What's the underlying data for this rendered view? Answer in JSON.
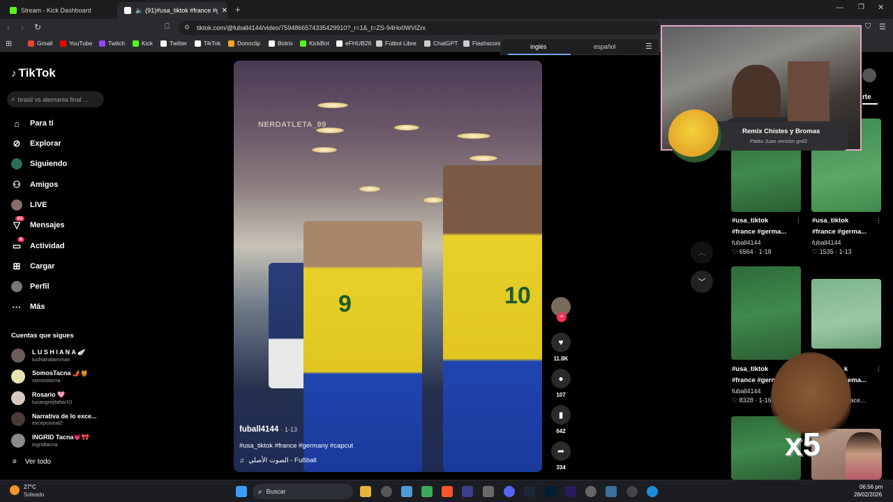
{
  "browser": {
    "tabs": [
      {
        "title": "Stream - Kick Dashboard",
        "color": "#53fc18"
      },
      {
        "title": "(91)#usa_tiktok #france #germ",
        "color": "#ffffff"
      }
    ],
    "url": "tiktok.com/@fuball4144/video/7594866574335429910?_r=1&_t=ZS-94Ho0WVlZrx",
    "bookmarks": [
      {
        "label": "Gmail",
        "color": "#ea4335"
      },
      {
        "label": "YouTube",
        "color": "#ff0000"
      },
      {
        "label": "Twitch",
        "color": "#9146ff"
      },
      {
        "label": "Kick",
        "color": "#53fc18"
      },
      {
        "label": "Twitter",
        "color": "#ffffff"
      },
      {
        "label": "TikTok",
        "color": "#ffffff"
      },
      {
        "label": "Donoclip",
        "color": "#f5a623"
      },
      {
        "label": "Botrix",
        "color": "#ffffff"
      },
      {
        "label": "KickBot",
        "color": "#53fc18"
      },
      {
        "label": "eFHUB26",
        "color": "#ffffff"
      },
      {
        "label": "Fútbol Libre",
        "color": "#cccccc"
      },
      {
        "label": "ChatGPT",
        "color": "#cccccc"
      },
      {
        "label": "Flashscore",
        "color": "#cccccc"
      }
    ],
    "translate": {
      "lang1": "inglés",
      "lang2": "español"
    }
  },
  "sidebar": {
    "logo": "TikTok",
    "search_placeholder": "brasil vs alemania final ...",
    "nav": [
      {
        "label": "Para ti",
        "icon": "home-icon"
      },
      {
        "label": "Explorar",
        "icon": "compass-icon"
      },
      {
        "label": "Siguiendo",
        "icon": "following-icon"
      },
      {
        "label": "Amigos",
        "icon": "friends-icon"
      },
      {
        "label": "LIVE",
        "icon": "live-icon"
      },
      {
        "label": "Mensajes",
        "icon": "messages-icon",
        "badge": "83"
      },
      {
        "label": "Actividad",
        "icon": "activity-icon",
        "badge": "8"
      },
      {
        "label": "Cargar",
        "icon": "upload-icon"
      },
      {
        "label": "Perfil",
        "icon": "profile-icon"
      },
      {
        "label": "Más",
        "icon": "more-icon"
      }
    ],
    "following_title": "Cuentas que sigues",
    "accounts": [
      {
        "name": "L U S H I A N A 🪽",
        "handle": "lushianalamman"
      },
      {
        "name": "SomosTacna 🌶️🍯",
        "handle": "somostacna"
      },
      {
        "name": "Rosario 🩷",
        "handle": "tucangrejitafav10"
      },
      {
        "name": "Narrativa de lo exce...",
        "handle": "excepcional2"
      },
      {
        "name": "INGRID Tacna💗🎀",
        "handle": "ingridtacna"
      }
    ],
    "see_all": "Ver todo"
  },
  "video": {
    "watermark": "NERDATLETA_99",
    "author": "fuball4144",
    "date": "· 1-13",
    "caption": "#usa_tiktok #france #germany #capcut",
    "sound": "الصوت الأصلي - Fußball",
    "likes": "11.8K",
    "comments": "107",
    "saves": "642",
    "shares": "334"
  },
  "grid": [
    {
      "title1": "#usa_tiktok",
      "title2": "#france #germa...",
      "author": "fuball4144",
      "likes": "6564",
      "date": "1-18"
    },
    {
      "title1": "#usa_tiktok",
      "title2": "#france #germa...",
      "author": "fuball4144",
      "likes": "1535",
      "date": "1-13"
    },
    {
      "title1": "#usa_tiktok",
      "title2": "#france #germ",
      "author": "fuball4144",
      "likes": "8328",
      "date": "1-16"
    },
    {
      "title1": "k",
      "title2": "ema...",
      "author": "",
      "likes": "",
      "date": "Hace..."
    }
  ],
  "right_partial": "rte",
  "overlay": {
    "name": "Remix Chistes y Bromas",
    "sub": "Patito Juan versión gml2",
    "badge": "x5"
  },
  "taskbar": {
    "temp": "27°C",
    "weather": "Soleado",
    "search": "Buscar",
    "time": "06:56 pm",
    "date": "28/02/2026"
  }
}
